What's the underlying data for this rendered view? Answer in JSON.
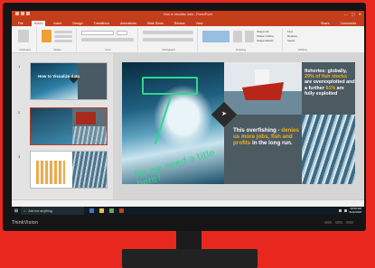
{
  "app": {
    "window_title": "How to visualize data - PowerPoint",
    "window_controls": [
      "—",
      "▢",
      "✕"
    ]
  },
  "ribbon": {
    "tabs": [
      "File",
      "Home",
      "Insert",
      "Design",
      "Transitions",
      "Animations",
      "Slide Show",
      "Review",
      "View"
    ],
    "active_tab": "Home",
    "right_tabs": [
      "Share",
      "Comments"
    ],
    "groups": [
      "Clipboard",
      "Slides",
      "Font",
      "Paragraph",
      "Drawing",
      "Editing"
    ],
    "editing_items": [
      "Find",
      "Replace",
      "Select"
    ],
    "shape_items": [
      "Shape Fill",
      "Shape Outline",
      "Shape Effects"
    ]
  },
  "thumbnails": {
    "items": [
      {
        "number": "1",
        "title": "How to Visualize data",
        "selected": false
      },
      {
        "number": "2",
        "title": "",
        "selected": true
      },
      {
        "number": "3",
        "title": "",
        "selected": false
      }
    ]
  },
  "slide": {
    "annotation": "Do we need a title here?",
    "top_right_text_pre": "fisheries: globally, ",
    "top_right_highlight": "29% of fish stocks",
    "top_right_text_mid": " are overexploited and a further ",
    "top_right_highlight2": "61%",
    "top_right_text_post": " are fully exploited",
    "mid_text_pre": "This overfishing - ",
    "mid_highlight": "denies us more jobs, fish and profits",
    "mid_text_post": " in the long run.",
    "icon": "fish-icon"
  },
  "taskbar": {
    "start_icon": "windows-icon",
    "search_placeholder": "Ask me anything",
    "time": "10:00 AM",
    "date": "8/22/2018"
  },
  "monitor": {
    "brand": "ThinkVision"
  },
  "colors": {
    "ppt_accent": "#c43e1c",
    "highlight": "#f2b01e",
    "annotation": "#2dd98a",
    "background": "#e8281e"
  }
}
